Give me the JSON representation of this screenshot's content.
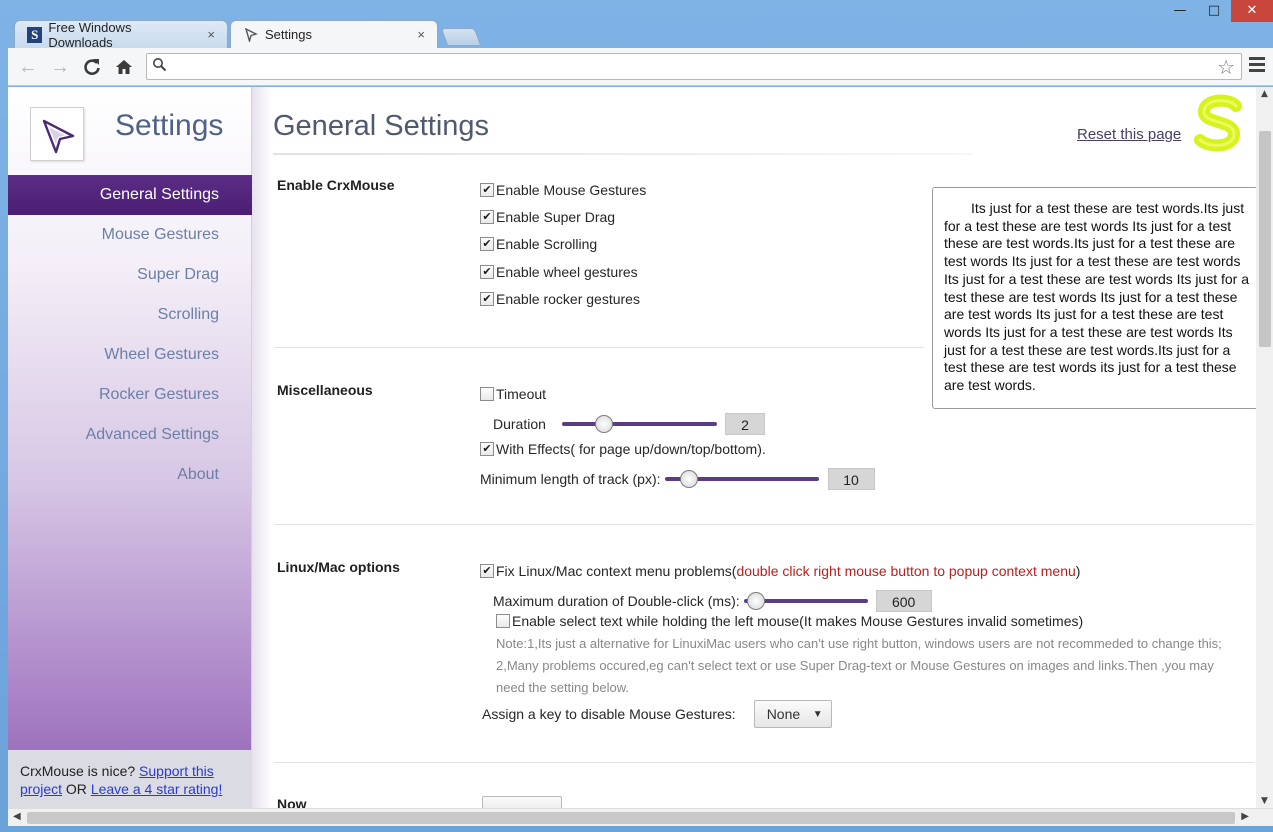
{
  "window": {
    "controls": {
      "minimize": "—",
      "maximize": "□",
      "close": "✕"
    }
  },
  "tabs": [
    {
      "label": "Free Windows Downloads",
      "favicon": "S",
      "close": "×"
    },
    {
      "label": "Settings",
      "close": "×"
    }
  ],
  "toolbar": {
    "omnibox_value": "",
    "icons": [
      "back-arrow-icon",
      "forward-arrow-icon",
      "reload-icon",
      "home-icon",
      "search-icon",
      "bookmark-star-icon",
      "menu-icon"
    ]
  },
  "sidebar": {
    "title": "Settings",
    "items": [
      {
        "label": "General Settings",
        "active": true
      },
      {
        "label": "Mouse Gestures"
      },
      {
        "label": "Super Drag"
      },
      {
        "label": "Scrolling"
      },
      {
        "label": "Wheel Gestures"
      },
      {
        "label": "Rocker Gestures"
      },
      {
        "label": "Advanced Settings"
      },
      {
        "label": "About"
      }
    ],
    "footer": {
      "prefix": "CrxMouse is nice? ",
      "support_link": "Support this project",
      "middle": " OR ",
      "rating_link": "Leave a 4 star rating!"
    }
  },
  "main": {
    "title": "General Settings",
    "reset_link": "Reset this page",
    "brand_colors": {
      "accent": "#5b2d85",
      "logo": "#d7f21c"
    },
    "sections": {
      "enable": {
        "label": "Enable CrxMouse",
        "options": [
          {
            "label": "Enable Mouse Gestures",
            "checked": true
          },
          {
            "label": "Enable Super Drag",
            "checked": true
          },
          {
            "label": "Enable Scrolling",
            "checked": true
          },
          {
            "label": "Enable wheel gestures",
            "checked": true
          },
          {
            "label": "Enable rocker gestures",
            "checked": true
          }
        ]
      },
      "misc": {
        "label": "Miscellaneous",
        "timeout": {
          "label": "Timeout",
          "checked": false
        },
        "duration": {
          "label": "Duration",
          "value": "2",
          "slider_fraction": 0.27
        },
        "effects": {
          "label": "With Effects( for page up/down/top/bottom).",
          "checked": true
        },
        "min_track": {
          "label": "Minimum length of track (px):",
          "value": "10",
          "slider_fraction": 0.16
        }
      },
      "linux": {
        "label": "Linux/Mac options",
        "fix": {
          "label": "Fix Linux/Mac context menu problems(",
          "hint": "double click right mouse button to popup context menu",
          "suffix": ")",
          "checked": true
        },
        "dblclick": {
          "label": "Maximum duration of Double-click (ms):",
          "value": "600",
          "slider_fraction": 0.1
        },
        "select_text": {
          "label": "Enable select text while holding the left mouse(It makes Mouse Gestures invalid sometimes)",
          "checked": false
        },
        "note_line1": "Note:1,Its just a alternative for LinuxiMac users who can't use right button, windows users are not recommeded to change this;",
        "note_line2": "2,Many problems occured,eg can't select text or use Super Drag-text or Mouse Gestures on images and links.Then ,you may",
        "note_line3": "need the setting below.",
        "assign_key": {
          "label": "Assign a key to disable Mouse Gestures:",
          "selected": "None"
        }
      },
      "now": {
        "label": "Now"
      }
    },
    "test_text": "Its just for a test these are test words.Its just for a test these are test words Its just for a test these are test words.Its just for a test these are test words Its just for a test these are test words Its just for a test these are test words Its just for a test these are test words Its just for a test these are test words Its just for a test these are test words Its just for a test these are test words Its just for a test these are test words.Its just for a test these are test words its just for a test these are test words."
  }
}
